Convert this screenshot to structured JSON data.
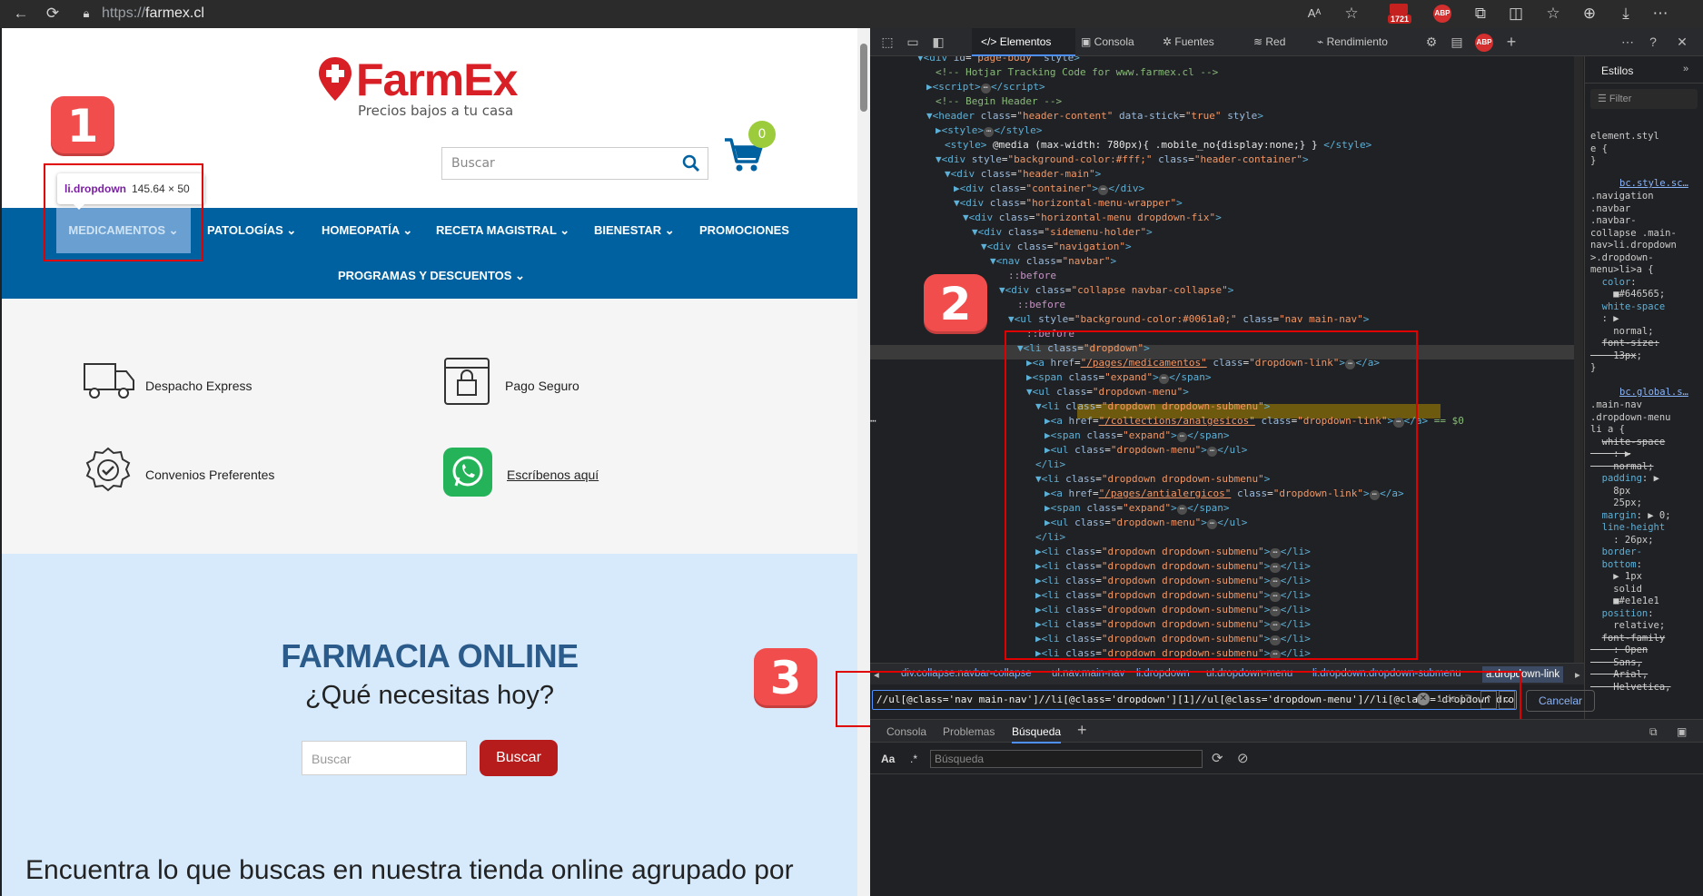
{
  "browser": {
    "url_scheme": "https://",
    "url_host": "farmex.cl",
    "notification_count": "1721",
    "abp_label": "ABP"
  },
  "site": {
    "logo": "FarmEx",
    "tagline": "Precios bajos a tu casa",
    "search_placeholder": "Buscar",
    "cart_count": "0",
    "nav": [
      "MEDICAMENTOS",
      "PATOLOGÍAS",
      "HOMEOPATÍA",
      "RECETA MAGISTRAL",
      "BIENESTAR",
      "PROMOCIONES",
      "PROGRAMAS Y DESCUENTOS"
    ],
    "tooltip_selector": "li.dropdown",
    "tooltip_size": "145.64 × 50",
    "features": [
      "Despacho Express",
      "Pago Seguro",
      "Convenios Preferentes",
      "Escríbenos aquí"
    ],
    "hero_title": "FARMACIA ONLINE",
    "hero_subtitle": "¿Qué necesitas hoy?",
    "hero_search_placeholder": "Buscar",
    "hero_button": "Buscar",
    "bottom_text": "Encuentra lo que buscas en nuestra tienda online agrupado por"
  },
  "markers": [
    "1",
    "2",
    "3"
  ],
  "devtools": {
    "tabs": [
      "Elementos",
      "Consola",
      "Fuentes",
      "Red",
      "Rendimiento"
    ],
    "styles_tab": "Estilos",
    "filter_placeholder": "Filter",
    "breadcrumbs": [
      "div.collapse.navbar-collapse",
      "ul.nav.main-nav",
      "li.dropdown",
      "ul.dropdown-menu",
      "li.dropdown.dropdown-submenu",
      "a.dropdown-link"
    ],
    "xpath": "//ul[@class='nav main-nav']//li[@class='dropdown'][1]//ul[@class='dropdown-menu']//li[@class='dropdown dro",
    "match_count": "1 de 17",
    "cancel": "Cancelar",
    "drawer_tabs": [
      "Consola",
      "Problemas",
      "Búsqueda"
    ],
    "drawer_search_placeholder": "Búsqueda",
    "case_toggle": "Aa",
    "regex_toggle": ".*"
  },
  "colors": {
    "navbar": "#0061a0",
    "brand_red": "#d91f26",
    "highlight": "#e00000"
  }
}
